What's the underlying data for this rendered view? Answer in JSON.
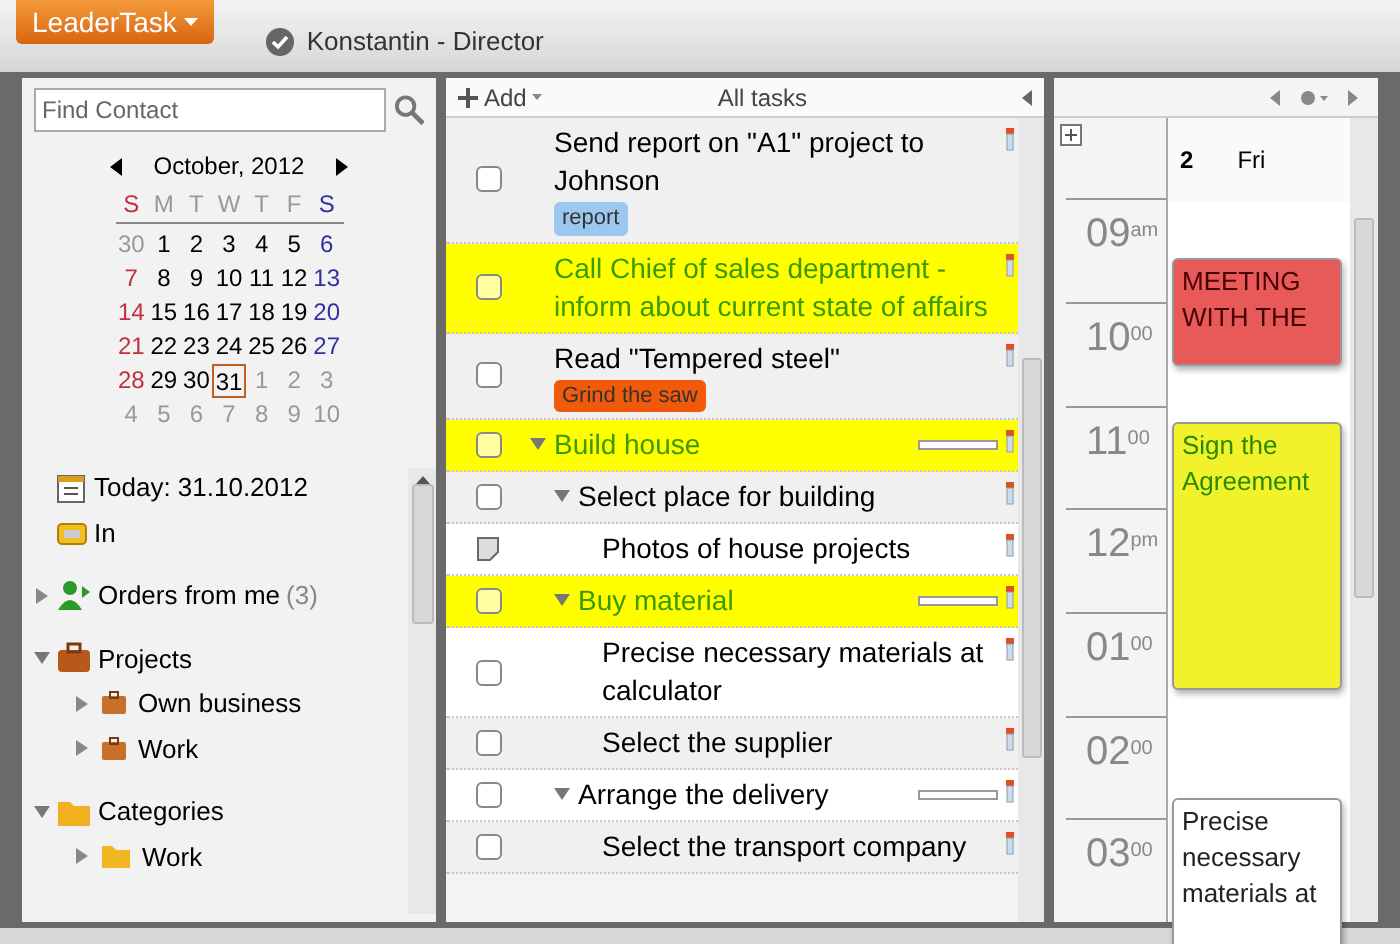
{
  "app_menu": {
    "label": "LeaderTask"
  },
  "user": {
    "name": "Konstantin - Director"
  },
  "search": {
    "placeholder": "Find Contact"
  },
  "calendar": {
    "month": "October, 2012",
    "weekdays": [
      "S",
      "M",
      "T",
      "W",
      "T",
      "F",
      "S"
    ],
    "weeks": [
      [
        {
          "day": "30",
          "muted": true,
          "selected": false
        },
        {
          "day": "1",
          "muted": false,
          "selected": false
        },
        {
          "day": "2",
          "muted": false,
          "selected": false
        },
        {
          "day": "3",
          "muted": false,
          "selected": false
        },
        {
          "day": "4",
          "muted": false,
          "selected": false
        },
        {
          "day": "5",
          "muted": false,
          "selected": false
        },
        {
          "day": "6",
          "muted": false,
          "selected": false
        }
      ],
      [
        {
          "day": "7",
          "muted": false,
          "selected": false
        },
        {
          "day": "8",
          "muted": false,
          "selected": false
        },
        {
          "day": "9",
          "muted": false,
          "selected": false
        },
        {
          "day": "10",
          "muted": false,
          "selected": false
        },
        {
          "day": "11",
          "muted": false,
          "selected": false
        },
        {
          "day": "12",
          "muted": false,
          "selected": false
        },
        {
          "day": "13",
          "muted": false,
          "selected": false
        }
      ],
      [
        {
          "day": "14",
          "muted": false,
          "selected": false
        },
        {
          "day": "15",
          "muted": false,
          "selected": false
        },
        {
          "day": "16",
          "muted": false,
          "selected": false
        },
        {
          "day": "17",
          "muted": false,
          "selected": false
        },
        {
          "day": "18",
          "muted": false,
          "selected": false
        },
        {
          "day": "19",
          "muted": false,
          "selected": false
        },
        {
          "day": "20",
          "muted": false,
          "selected": false
        }
      ],
      [
        {
          "day": "21",
          "muted": false,
          "selected": false
        },
        {
          "day": "22",
          "muted": false,
          "selected": false
        },
        {
          "day": "23",
          "muted": false,
          "selected": false
        },
        {
          "day": "24",
          "muted": false,
          "selected": false
        },
        {
          "day": "25",
          "muted": false,
          "selected": false
        },
        {
          "day": "26",
          "muted": false,
          "selected": false
        },
        {
          "day": "27",
          "muted": false,
          "selected": false
        }
      ],
      [
        {
          "day": "28",
          "muted": false,
          "selected": false
        },
        {
          "day": "29",
          "muted": false,
          "selected": false
        },
        {
          "day": "30",
          "muted": false,
          "selected": false
        },
        {
          "day": "31",
          "muted": false,
          "selected": true
        },
        {
          "day": "1",
          "muted": true,
          "selected": false
        },
        {
          "day": "2",
          "muted": true,
          "selected": false
        },
        {
          "day": "3",
          "muted": true,
          "selected": false
        }
      ],
      [
        {
          "day": "4",
          "muted": true,
          "selected": false
        },
        {
          "day": "5",
          "muted": true,
          "selected": false
        },
        {
          "day": "6",
          "muted": true,
          "selected": false
        },
        {
          "day": "7",
          "muted": true,
          "selected": false
        },
        {
          "day": "8",
          "muted": true,
          "selected": false
        },
        {
          "day": "9",
          "muted": true,
          "selected": false
        },
        {
          "day": "10",
          "muted": true,
          "selected": false
        }
      ]
    ]
  },
  "sidebar": {
    "sections": [
      {
        "items": [
          {
            "kind": "today",
            "label": "Today: 31.10.2012"
          },
          {
            "kind": "inbox",
            "label": "In"
          }
        ]
      },
      {
        "items": [
          {
            "kind": "orders",
            "label": "Orders from me",
            "count": "(3)",
            "expanded": false
          }
        ]
      },
      {
        "items": [
          {
            "kind": "projects",
            "label": "Projects",
            "expanded": true,
            "children": [
              {
                "label": "Own business",
                "expanded": false
              },
              {
                "label": "Work",
                "expanded": false
              }
            ]
          }
        ]
      },
      {
        "items": [
          {
            "kind": "categories",
            "label": "Categories",
            "expanded": true,
            "children": [
              {
                "label": "Work",
                "expanded": false
              }
            ]
          }
        ]
      }
    ]
  },
  "tasks_toolbar": {
    "add": "Add",
    "title": "All tasks"
  },
  "tasks": [
    {
      "title": "Send report on \"A1\" project to Johnson",
      "kind": "task",
      "highlighted": false,
      "tag": {
        "text": "report",
        "color": "#9cc8f0"
      }
    },
    {
      "title": "Call Chief of sales department - inform about current state of affairs",
      "kind": "task",
      "highlighted": true
    },
    {
      "title": "Read \"Tempered steel\"",
      "kind": "task",
      "highlighted": false,
      "tag": {
        "text": "Grind the saw",
        "color": "#f05a0a"
      }
    },
    {
      "title": "Build house",
      "kind": "task",
      "highlighted": true,
      "expanded": true,
      "level": 0,
      "children": [
        {
          "title": "Select place for building",
          "kind": "task",
          "highlighted": false,
          "expanded": true,
          "children": [
            {
              "title": "Photos of house projects",
              "kind": "note",
              "highlighted": false
            }
          ]
        },
        {
          "title": "Buy material",
          "kind": "task",
          "highlighted": true,
          "expanded": true,
          "level": 0,
          "children": [
            {
              "title": "Precise necessary materials at calculator",
              "kind": "task",
              "highlighted": false
            },
            {
              "title": "Select the supplier",
              "kind": "task",
              "highlighted": false
            }
          ]
        },
        {
          "title": "Arrange the delivery",
          "kind": "task",
          "highlighted": false,
          "expanded": true,
          "level": 0,
          "children": [
            {
              "title": "Select the transport company",
              "kind": "task",
              "highlighted": false
            }
          ]
        }
      ]
    }
  ],
  "day_view": {
    "date": "2",
    "weekday": "Fri",
    "hours": [
      "09$^{am}$",
      "10$^{00}$",
      "11$^{00}$",
      "12$^{pm}$",
      "01$^{00}$",
      "02$^{00}$",
      "03$^{00}$"
    ],
    "events": [
      {
        "title": "MEETING WITH THE",
        "color": "#e85a5a"
      },
      {
        "title": "Sign the Agreement",
        "color": "#f2f22a"
      },
      {
        "title": "Precise necessary materials at",
        "color": "#ffffff"
      }
    ]
  }
}
